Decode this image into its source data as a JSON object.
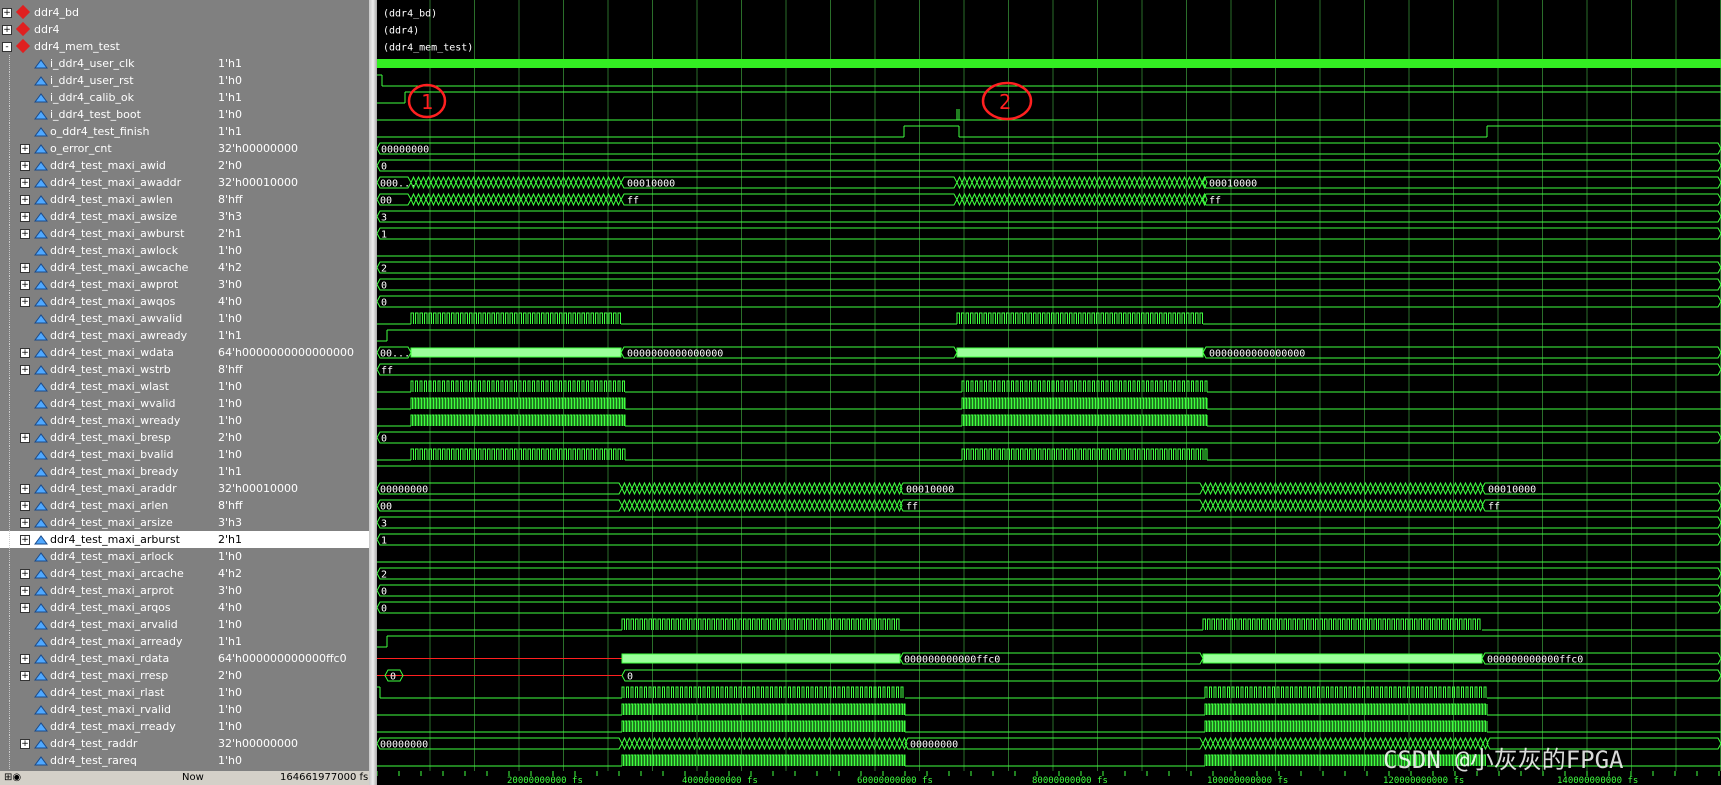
{
  "signals": [
    {
      "name": "ddr4_bd",
      "value": "",
      "kind": "group",
      "expander": "+",
      "indent": 0
    },
    {
      "name": "ddr4",
      "value": "",
      "kind": "group",
      "expander": "+",
      "indent": 0
    },
    {
      "name": "ddr4_mem_test",
      "value": "",
      "kind": "group",
      "expander": "-",
      "indent": 0
    },
    {
      "name": "i_ddr4_user_clk",
      "value": "1'h1",
      "kind": "signal",
      "indent": 1
    },
    {
      "name": "i_ddr4_user_rst",
      "value": "1'h0",
      "kind": "signal",
      "indent": 1
    },
    {
      "name": "i_ddr4_calib_ok",
      "value": "1'h1",
      "kind": "signal",
      "indent": 1
    },
    {
      "name": "i_ddr4_test_boot",
      "value": "1'h0",
      "kind": "signal",
      "indent": 1
    },
    {
      "name": "o_ddr4_test_finish",
      "value": "1'h1",
      "kind": "signal",
      "indent": 1
    },
    {
      "name": "o_error_cnt",
      "value": "32'h00000000",
      "kind": "bus",
      "expander": "+",
      "indent": 1
    },
    {
      "name": "ddr4_test_maxi_awid",
      "value": "2'h0",
      "kind": "bus",
      "expander": "+",
      "indent": 1
    },
    {
      "name": "ddr4_test_maxi_awaddr",
      "value": "32'h00010000",
      "kind": "bus",
      "expander": "+",
      "indent": 1
    },
    {
      "name": "ddr4_test_maxi_awlen",
      "value": "8'hff",
      "kind": "bus",
      "expander": "+",
      "indent": 1
    },
    {
      "name": "ddr4_test_maxi_awsize",
      "value": "3'h3",
      "kind": "bus",
      "expander": "+",
      "indent": 1
    },
    {
      "name": "ddr4_test_maxi_awburst",
      "value": "2'h1",
      "kind": "bus",
      "expander": "+",
      "indent": 1
    },
    {
      "name": "ddr4_test_maxi_awlock",
      "value": "1'h0",
      "kind": "signal",
      "indent": 1
    },
    {
      "name": "ddr4_test_maxi_awcache",
      "value": "4'h2",
      "kind": "bus",
      "expander": "+",
      "indent": 1
    },
    {
      "name": "ddr4_test_maxi_awprot",
      "value": "3'h0",
      "kind": "bus",
      "expander": "+",
      "indent": 1
    },
    {
      "name": "ddr4_test_maxi_awqos",
      "value": "4'h0",
      "kind": "bus",
      "expander": "+",
      "indent": 1
    },
    {
      "name": "ddr4_test_maxi_awvalid",
      "value": "1'h0",
      "kind": "signal",
      "indent": 1
    },
    {
      "name": "ddr4_test_maxi_awready",
      "value": "1'h1",
      "kind": "signal",
      "indent": 1
    },
    {
      "name": "ddr4_test_maxi_wdata",
      "value": "64'h0000000000000000",
      "kind": "bus",
      "expander": "+",
      "indent": 1
    },
    {
      "name": "ddr4_test_maxi_wstrb",
      "value": "8'hff",
      "kind": "bus",
      "expander": "+",
      "indent": 1
    },
    {
      "name": "ddr4_test_maxi_wlast",
      "value": "1'h0",
      "kind": "signal",
      "indent": 1
    },
    {
      "name": "ddr4_test_maxi_wvalid",
      "value": "1'h0",
      "kind": "signal",
      "indent": 1
    },
    {
      "name": "ddr4_test_maxi_wready",
      "value": "1'h0",
      "kind": "signal",
      "indent": 1
    },
    {
      "name": "ddr4_test_maxi_bresp",
      "value": "2'h0",
      "kind": "bus",
      "expander": "+",
      "indent": 1
    },
    {
      "name": "ddr4_test_maxi_bvalid",
      "value": "1'h0",
      "kind": "signal",
      "indent": 1
    },
    {
      "name": "ddr4_test_maxi_bready",
      "value": "1'h1",
      "kind": "signal",
      "indent": 1
    },
    {
      "name": "ddr4_test_maxi_araddr",
      "value": "32'h00010000",
      "kind": "bus",
      "expander": "+",
      "indent": 1
    },
    {
      "name": "ddr4_test_maxi_arlen",
      "value": "8'hff",
      "kind": "bus",
      "expander": "+",
      "indent": 1
    },
    {
      "name": "ddr4_test_maxi_arsize",
      "value": "3'h3",
      "kind": "bus",
      "expander": "+",
      "indent": 1
    },
    {
      "name": "ddr4_test_maxi_arburst",
      "value": "2'h1",
      "kind": "bus",
      "expander": "+",
      "indent": 1,
      "selected": true
    },
    {
      "name": "ddr4_test_maxi_arlock",
      "value": "1'h0",
      "kind": "signal",
      "indent": 1
    },
    {
      "name": "ddr4_test_maxi_arcache",
      "value": "4'h2",
      "kind": "bus",
      "expander": "+",
      "indent": 1
    },
    {
      "name": "ddr4_test_maxi_arprot",
      "value": "3'h0",
      "kind": "bus",
      "expander": "+",
      "indent": 1
    },
    {
      "name": "ddr4_test_maxi_arqos",
      "value": "4'h0",
      "kind": "bus",
      "expander": "+",
      "indent": 1
    },
    {
      "name": "ddr4_test_maxi_arvalid",
      "value": "1'h0",
      "kind": "signal",
      "indent": 1
    },
    {
      "name": "ddr4_test_maxi_arready",
      "value": "1'h1",
      "kind": "signal",
      "indent": 1
    },
    {
      "name": "ddr4_test_maxi_rdata",
      "value": "64'h000000000000ffc0",
      "kind": "bus",
      "expander": "+",
      "indent": 1
    },
    {
      "name": "ddr4_test_maxi_rresp",
      "value": "2'h0",
      "kind": "bus",
      "expander": "+",
      "indent": 1
    },
    {
      "name": "ddr4_test_maxi_rlast",
      "value": "1'h0",
      "kind": "signal",
      "indent": 1
    },
    {
      "name": "ddr4_test_maxi_rvalid",
      "value": "1'h0",
      "kind": "signal",
      "indent": 1
    },
    {
      "name": "ddr4_test_maxi_rready",
      "value": "1'h0",
      "kind": "signal",
      "indent": 1
    },
    {
      "name": "ddr4_test_raddr",
      "value": "32'h00000000",
      "kind": "bus",
      "expander": "+",
      "indent": 1
    },
    {
      "name": "ddr4_test_rareq",
      "value": "1'h0",
      "kind": "signal",
      "indent": 1
    }
  ],
  "group_labels": [
    "(ddr4_bd)",
    "(ddr4)",
    "(ddr4_mem_test)"
  ],
  "bus_labels": {
    "o_error_cnt": "00000000",
    "awid": "0",
    "awaddr_start": "000...",
    "awaddr_end1": "00010000",
    "awaddr_end2": "00010000",
    "awlen_start": "00",
    "awlen_end1": "ff",
    "awlen_end2": "ff",
    "awsize": "3",
    "awburst": "1",
    "awcache": "2",
    "awprot": "0",
    "awqos": "0",
    "wdata_start": "00...",
    "wdata_end1": "0000000000000000",
    "wdata_end2": "0000000000000000",
    "wstrb": "ff",
    "bresp": "0",
    "araddr_start": "00000000",
    "araddr_end1": "00010000",
    "araddr_end2": "00010000",
    "arlen_start": "00",
    "arlen_end1": "ff",
    "arlen_end2": "ff",
    "arsize": "3",
    "arburst": "1",
    "arcache": "2",
    "arprot": "0",
    "arqos": "0",
    "rdata_end1": "000000000000ffc0",
    "rdata_end2": "000000000000ffc0",
    "rresp_x": "0",
    "rresp": "0",
    "raddr_start": "00000000",
    "raddr_end": "00000000"
  },
  "annotations": [
    "1",
    "2"
  ],
  "footer": {
    "now_label": "Now",
    "now_value": "164661977000 fs",
    "time_ticks": [
      "20000000000 fs",
      "40000000000 fs",
      "60000000000 fs",
      "80000000000 fs",
      "100000000000 fs",
      "120000000000 fs",
      "140000000000 fs"
    ]
  },
  "watermark": "CSDN @小灰灰的FPGA",
  "colors": {
    "wave": "#3fff3f",
    "bus_fill": "#9bff9b",
    "x_state": "#ff2020",
    "grid": "#2a6e2a",
    "panel": "#808080"
  }
}
